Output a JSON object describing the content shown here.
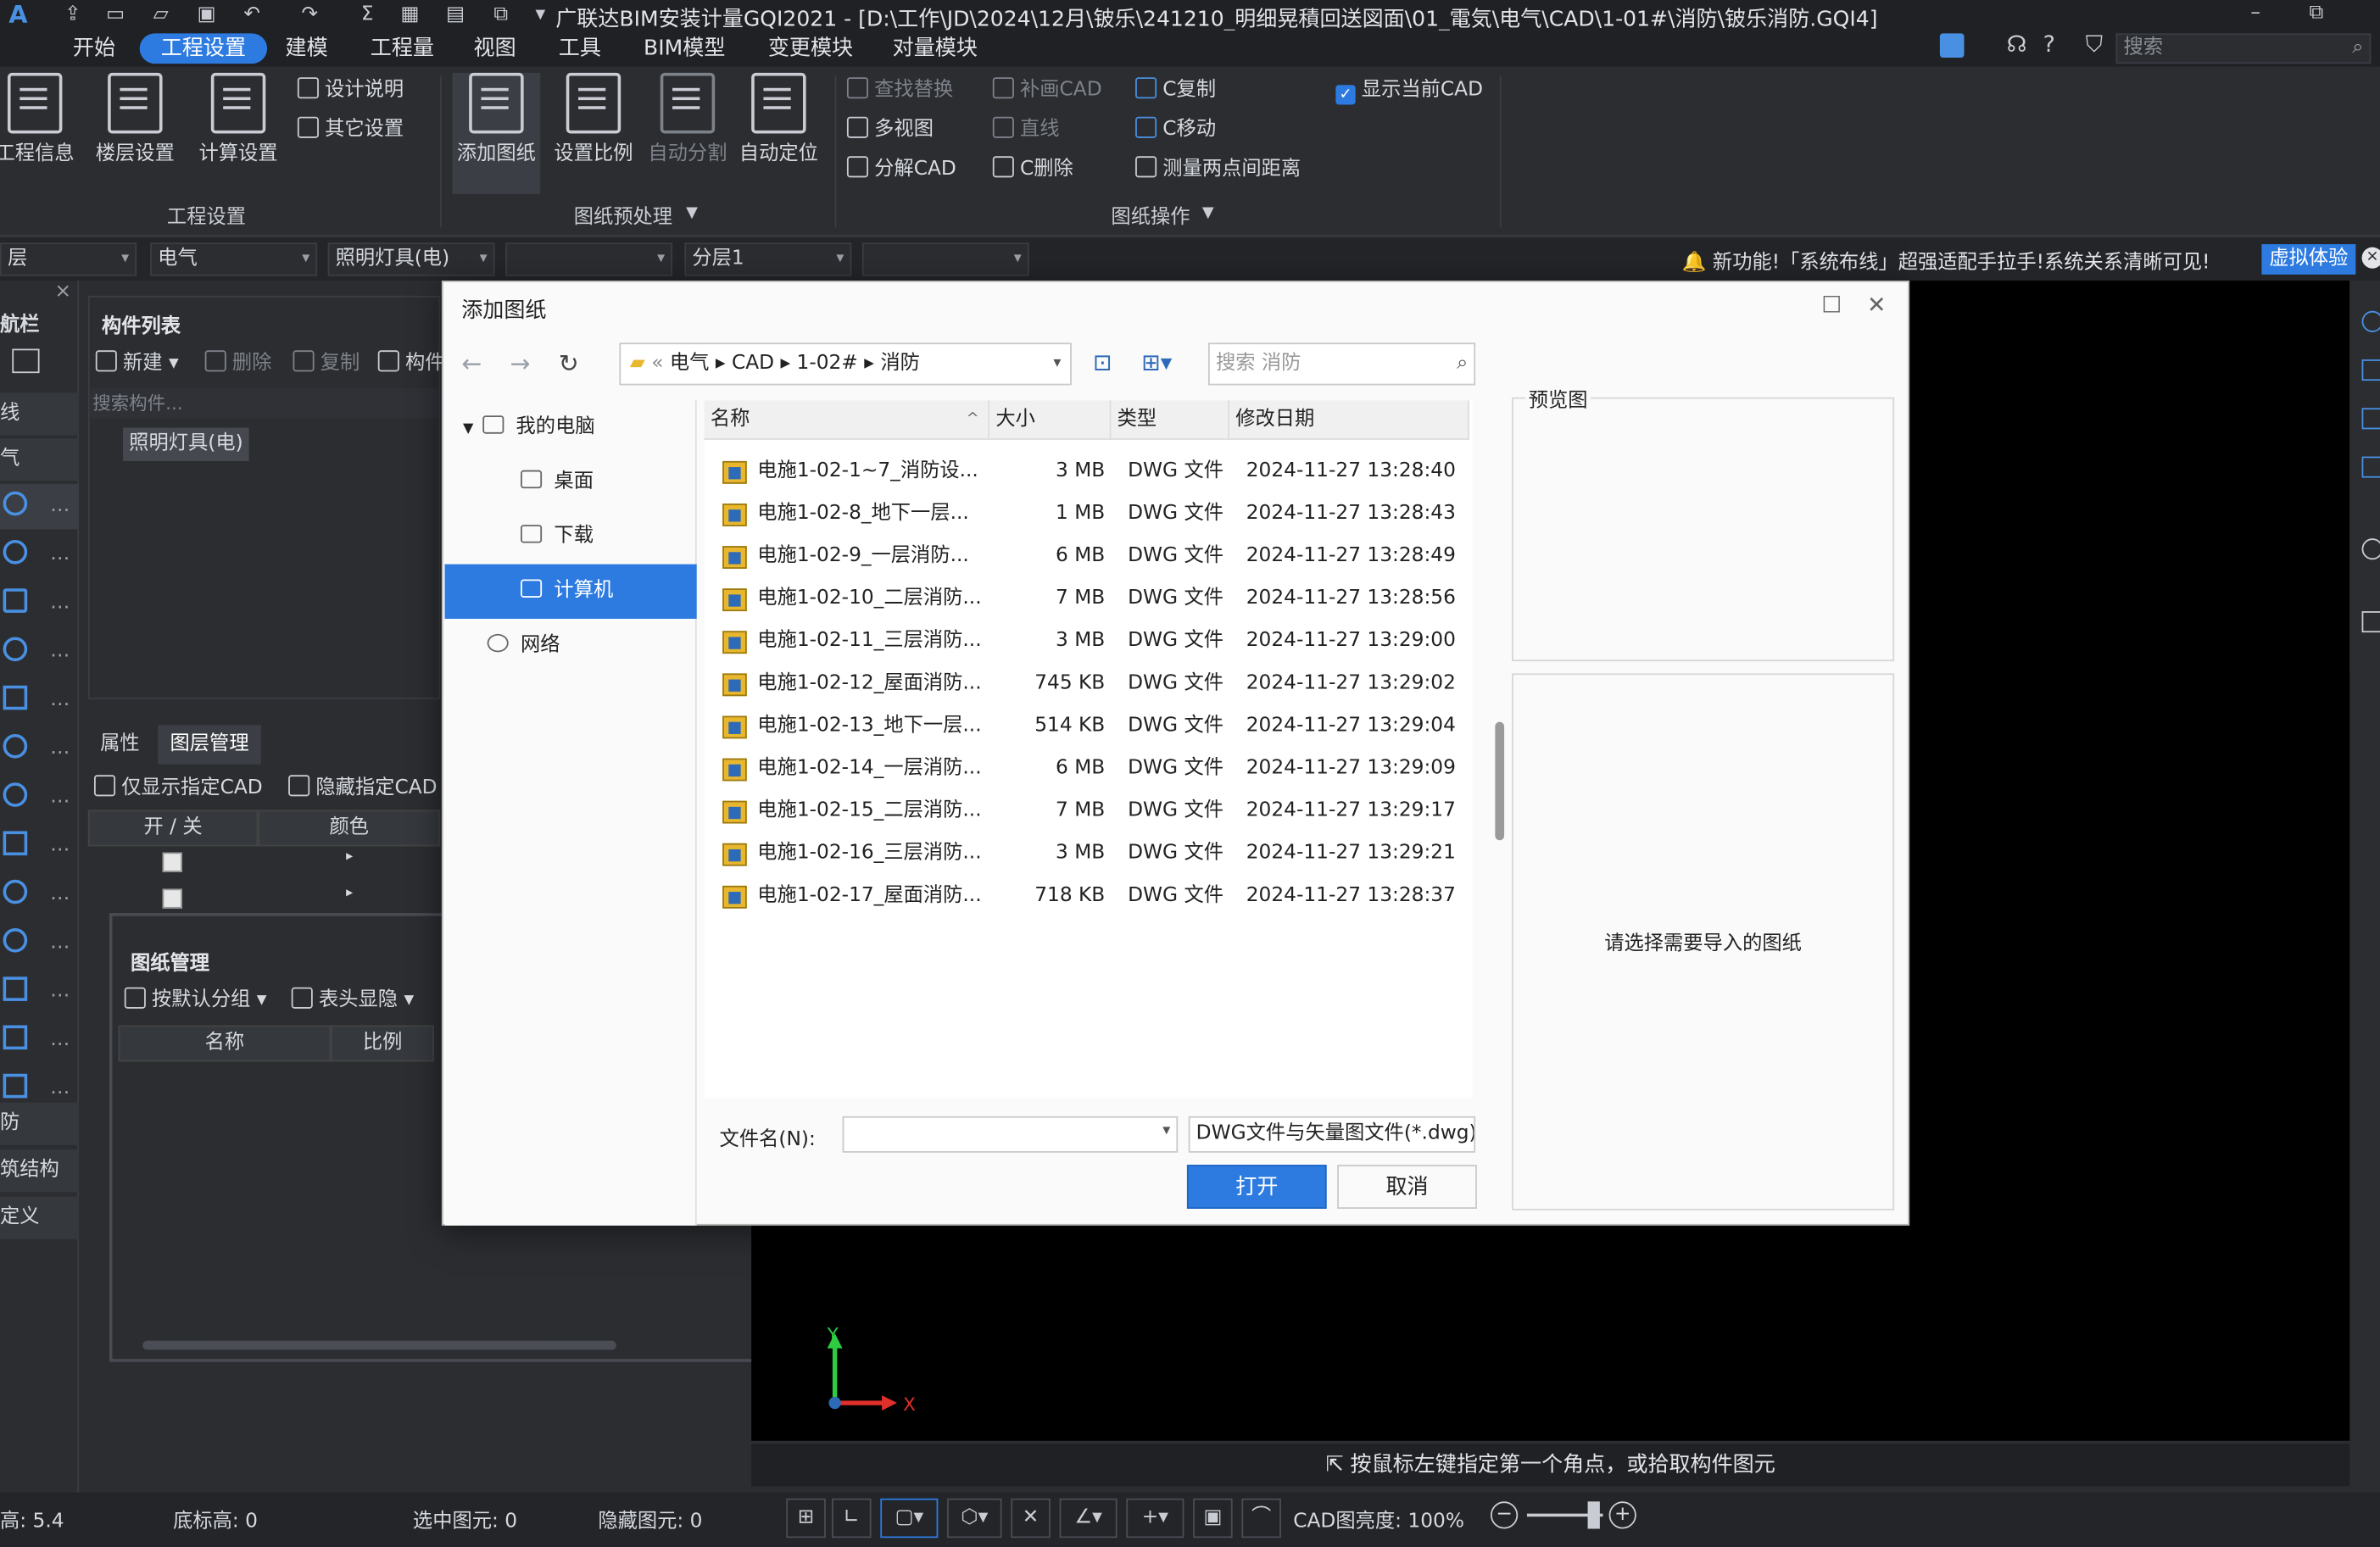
{
  "window": {
    "title": "广联达BIM安装计量GQI2021 - [D:\\工作\\JD\\2024\\12月\\铍乐\\241210_明细晃積回送図面\\01_電気\\电气\\CAD\\1-01#\\消防\\铍乐消防.GQI4]"
  },
  "menu": {
    "items": [
      "开始",
      "工程设置",
      "建模",
      "工程量",
      "视图",
      "工具",
      "BIM模型",
      "变更模块",
      "对量模块"
    ],
    "active": "工程设置",
    "search_placeholder": "搜索"
  },
  "ribbon": {
    "group1": {
      "label": "工程设置",
      "buttons": [
        "工程信息",
        "楼层设置",
        "计算设置"
      ],
      "small": [
        "设计说明",
        "其它设置"
      ]
    },
    "group2": {
      "label": "图纸预处理",
      "buttons": [
        "添加图纸",
        "设置比例",
        "自动分割",
        "自动定位"
      ]
    },
    "group3": {
      "label": "图纸操作",
      "small_col1": [
        "查找替换",
        "多视图",
        "分解CAD"
      ],
      "small_col2": [
        "补画CAD",
        "直线",
        "C删除"
      ],
      "small_col3": [
        "C复制",
        "C移动",
        "测量两点间距离"
      ],
      "checkbox": "显示当前CAD"
    }
  },
  "filterbar": {
    "combo1": "层",
    "combo2": "电气",
    "combo3": "照明灯具(电)",
    "combo4": "",
    "combo5": "分层1",
    "combo6": "",
    "notice": "新功能!「系统布线」超强适配手拉手!系统关系清晰可见!",
    "try_button": "虚拟体验"
  },
  "leftnav": {
    "title": "航栏",
    "text_rows": [
      "线",
      "气",
      "防",
      "筑结构",
      "定义"
    ]
  },
  "component_panel": {
    "title": "构件列表",
    "toolbar": [
      "新建",
      "删除",
      "复制",
      "构件"
    ],
    "search_placeholder": "搜索构件...",
    "item": "照明灯具(电)"
  },
  "property_panel": {
    "tabs": [
      "属性",
      "图层管理"
    ],
    "toolbar": [
      "仅显示指定CAD",
      "隐藏指定CAD"
    ],
    "columns": [
      "开 / 关",
      "颜色"
    ]
  },
  "drawing_panel": {
    "title": "图纸管理",
    "toolbar": [
      "按默认分组",
      "表头显隐"
    ],
    "columns": [
      "名称",
      "比例"
    ]
  },
  "status": {
    "hint": "按鼠标左键指定第一个角点，或拾取构件图元",
    "height": "高: 5.4",
    "bottom": "底标高: 0",
    "selected": "选中图元: 0",
    "hidden": "隐藏图元: 0",
    "brightness": "CAD图亮度: 100%"
  },
  "dialog": {
    "title": "添加图纸",
    "breadcrumb": [
      "电气",
      "CAD",
      "1-02#",
      "消防"
    ],
    "search_placeholder": "搜索 消防",
    "tree": [
      {
        "label": "我的电脑"
      },
      {
        "label": "桌面"
      },
      {
        "label": "下载"
      },
      {
        "label": "计算机"
      },
      {
        "label": "网络"
      }
    ],
    "columns": [
      "名称",
      "大小",
      "类型",
      "修改日期"
    ],
    "files": [
      {
        "name": "电施1-02-1~7_消防设...",
        "size": "3 MB",
        "type": "DWG 文件",
        "date": "2024-11-27 13:28:40"
      },
      {
        "name": "电施1-02-8_地下一层...",
        "size": "1 MB",
        "type": "DWG 文件",
        "date": "2024-11-27 13:28:43"
      },
      {
        "name": "电施1-02-9_一层消防...",
        "size": "6 MB",
        "type": "DWG 文件",
        "date": "2024-11-27 13:28:49"
      },
      {
        "name": "电施1-02-10_二层消防...",
        "size": "7 MB",
        "type": "DWG 文件",
        "date": "2024-11-27 13:28:56"
      },
      {
        "name": "电施1-02-11_三层消防...",
        "size": "3 MB",
        "type": "DWG 文件",
        "date": "2024-11-27 13:29:00"
      },
      {
        "name": "电施1-02-12_屋面消防...",
        "size": "745 KB",
        "type": "DWG 文件",
        "date": "2024-11-27 13:29:02"
      },
      {
        "name": "电施1-02-13_地下一层...",
        "size": "514 KB",
        "type": "DWG 文件",
        "date": "2024-11-27 13:29:04"
      },
      {
        "name": "电施1-02-14_一层消防...",
        "size": "6 MB",
        "type": "DWG 文件",
        "date": "2024-11-27 13:29:09"
      },
      {
        "name": "电施1-02-15_二层消防...",
        "size": "7 MB",
        "type": "DWG 文件",
        "date": "2024-11-27 13:29:17"
      },
      {
        "name": "电施1-02-16_三层消防...",
        "size": "3 MB",
        "type": "DWG 文件",
        "date": "2024-11-27 13:29:21"
      },
      {
        "name": "电施1-02-17_屋面消防...",
        "size": "718 KB",
        "type": "DWG 文件",
        "date": "2024-11-27 13:28:37"
      }
    ],
    "preview_label": "预览图",
    "preview_hint": "请选择需要导入的图纸",
    "filename_label": "文件名(N):",
    "filename_value": "",
    "filetype": "DWG文件与矢量图文件(*.dwg)",
    "ok": "打开",
    "cancel": "取消"
  },
  "colors": {
    "accent": "#2d7be0",
    "background": "#2b2d31",
    "cad": "#000000"
  }
}
